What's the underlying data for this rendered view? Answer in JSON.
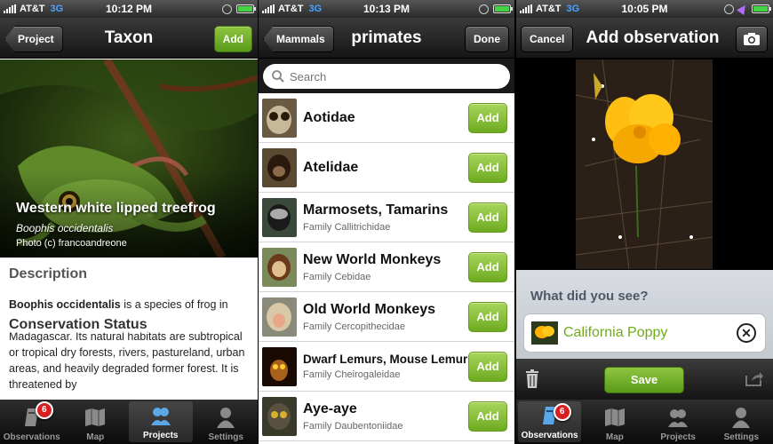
{
  "panel1": {
    "status": {
      "carrier": "AT&T",
      "network": "3G",
      "time": "10:12 PM"
    },
    "nav": {
      "back": "Project",
      "title": "Taxon",
      "action": "Add"
    },
    "hero": {
      "common_name": "Western white lipped treefrog",
      "scientific_name": "Boophis occidentalis",
      "photo_credit": "Photo (c) francoandreone"
    },
    "description": {
      "heading": "Description",
      "bold_name": "Boophis occidentalis",
      "text": " is a species of frog in",
      "conservation_heading": "Conservation Status",
      "text2": "Madagascar. Its natural habitats are subtropical or tropical dry forests, rivers, pastureland, urban areas, and heavily degraded former forest. It is threatened by"
    },
    "tabs": [
      {
        "label": "Observations",
        "icon": "observations-icon",
        "badge": "6"
      },
      {
        "label": "Map",
        "icon": "map-icon"
      },
      {
        "label": "Projects",
        "icon": "projects-icon"
      },
      {
        "label": "Settings",
        "icon": "settings-icon"
      }
    ]
  },
  "panel2": {
    "status": {
      "carrier": "AT&T",
      "network": "3G",
      "time": "10:13 PM"
    },
    "nav": {
      "back": "Mammals",
      "title": "primates",
      "action": "Done"
    },
    "search": {
      "placeholder": "Search"
    },
    "rows": [
      {
        "title": "Aotidae",
        "subtitle": "",
        "action": "Add"
      },
      {
        "title": "Atelidae",
        "subtitle": "",
        "action": "Add"
      },
      {
        "title": "Marmosets, Tamarins",
        "subtitle": "Family Callitrichidae",
        "action": "Add"
      },
      {
        "title": "New World Monkeys",
        "subtitle": "Family Cebidae",
        "action": "Add"
      },
      {
        "title": "Old World Monkeys",
        "subtitle": "Family Cercopithecidae",
        "action": "Add"
      },
      {
        "title": "Dwarf Lemurs, Mouse Lemur",
        "subtitle": "Family Cheirogaleidae",
        "action": "Add"
      },
      {
        "title": "Aye-aye",
        "subtitle": "Family Daubentoniidae",
        "action": "Add"
      }
    ]
  },
  "panel3": {
    "status": {
      "carrier": "AT&T",
      "network": "3G",
      "time": "10:05 PM"
    },
    "nav": {
      "back": "Cancel",
      "title": "Add observation"
    },
    "question": "What did you see?",
    "species": "California Poppy",
    "save": "Save",
    "tabs": [
      {
        "label": "Observations",
        "icon": "observations-icon",
        "badge": "6"
      },
      {
        "label": "Map",
        "icon": "map-icon"
      },
      {
        "label": "Projects",
        "icon": "projects-icon"
      },
      {
        "label": "Settings",
        "icon": "settings-icon"
      }
    ]
  },
  "colors": {
    "accent_green": "#6eaa22",
    "badge_red": "#d81e1e",
    "species_green": "#6eab1a"
  }
}
